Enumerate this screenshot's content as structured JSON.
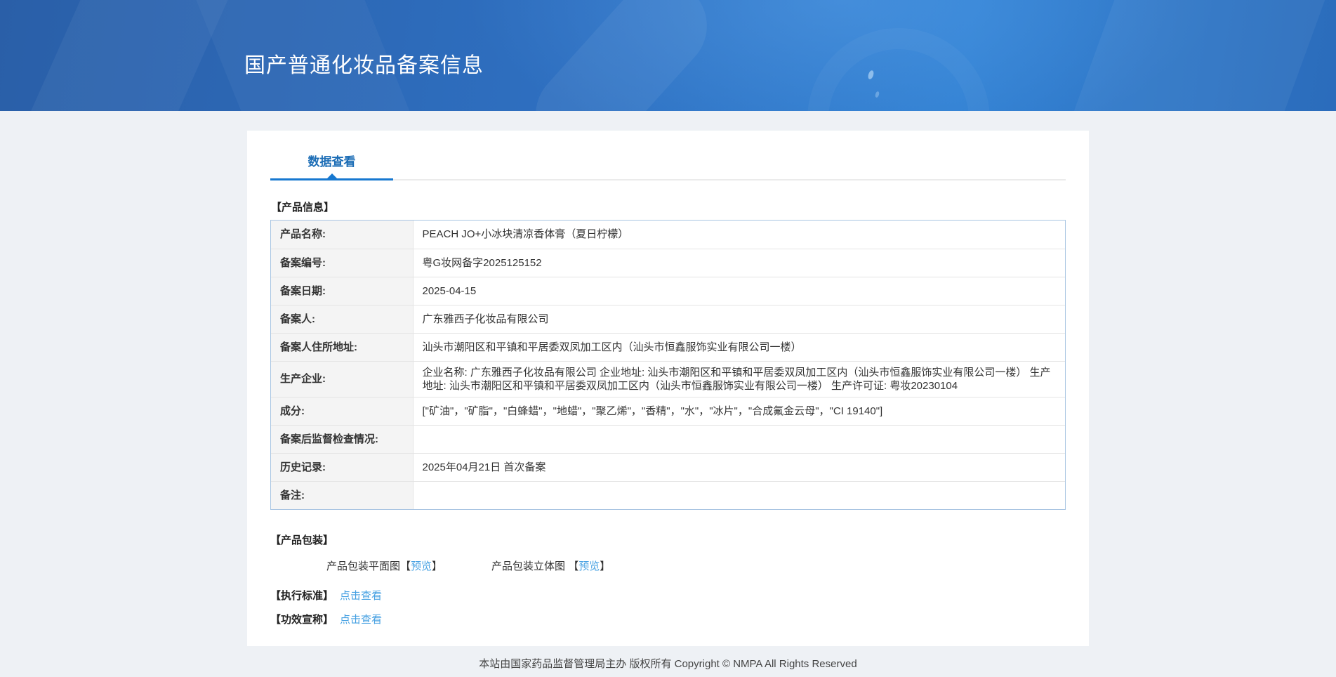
{
  "banner": {
    "title": "国产普通化妆品备案信息"
  },
  "tabs": [
    {
      "label": "数据查看",
      "active": true
    }
  ],
  "product_info": {
    "section_title": "【产品信息】",
    "rows": [
      {
        "label": "产品名称:",
        "value": "PEACH JO+小冰块清凉香体膏（夏日柠檬）"
      },
      {
        "label": "备案编号:",
        "value": "粤G妆网备字2025125152"
      },
      {
        "label": "备案日期:",
        "value": "2025-04-15"
      },
      {
        "label": "备案人:",
        "value": "广东雅西子化妆品有限公司"
      },
      {
        "label": "备案人住所地址:",
        "value": "汕头市潮阳区和平镇和平居委双凤加工区内（汕头市恒鑫服饰实业有限公司一楼）"
      },
      {
        "label": "生产企业:",
        "value": "企业名称: 广东雅西子化妆品有限公司 企业地址: 汕头市潮阳区和平镇和平居委双凤加工区内（汕头市恒鑫服饰实业有限公司一楼） 生产地址: 汕头市潮阳区和平镇和平居委双凤加工区内（汕头市恒鑫服饰实业有限公司一楼） 生产许可证: 粤妆20230104"
      },
      {
        "label": "成分:",
        "value": "[\"矿油\"，\"矿脂\"，\"白蜂蜡\"，\"地蜡\"，\"聚乙烯\"，\"香精\"，\"水\"，\"冰片\"，\"合成氟金云母\"，\"CI 19140\"]"
      },
      {
        "label": "备案后监督检查情况:",
        "value": ""
      },
      {
        "label": "历史记录:",
        "value": "2025年04月21日 首次备案"
      },
      {
        "label": "备注:",
        "value": ""
      }
    ]
  },
  "packaging": {
    "section_title": "【产品包装】",
    "items": [
      {
        "prefix": "产品包装平面图【",
        "link_label": "预览",
        "suffix": "】"
      },
      {
        "prefix": "产品包装立体图 【",
        "link_label": "预览",
        "suffix": "】"
      }
    ]
  },
  "extra_links": [
    {
      "bracket_label": "【执行标准】",
      "link_label": "点击查看"
    },
    {
      "bracket_label": "【功效宣称】",
      "link_label": "点击查看"
    }
  ],
  "footer": {
    "text": "本站由国家药品监督管理局主办 版权所有 Copyright © NMPA All Rights Reserved"
  },
  "colors": {
    "accent": "#1b6cb5",
    "accent-bright": "#1778d0",
    "link": "#45a0e2",
    "banner-start": "#2a5fa8",
    "banner-end": "#3180d2"
  }
}
